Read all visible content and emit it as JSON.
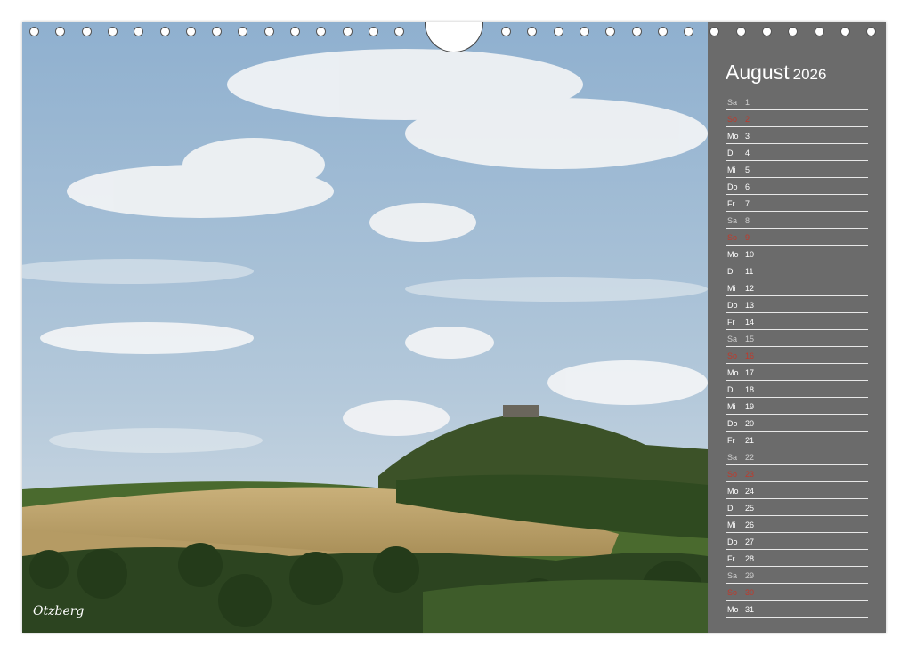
{
  "calendar": {
    "month": "August",
    "year": "2026",
    "caption": "Otzberg",
    "days": [
      {
        "abbr": "Sa",
        "num": "1",
        "kind": "sat"
      },
      {
        "abbr": "So",
        "num": "2",
        "kind": "sun"
      },
      {
        "abbr": "Mo",
        "num": "3",
        "kind": "wk"
      },
      {
        "abbr": "Di",
        "num": "4",
        "kind": "wk"
      },
      {
        "abbr": "Mi",
        "num": "5",
        "kind": "wk"
      },
      {
        "abbr": "Do",
        "num": "6",
        "kind": "wk"
      },
      {
        "abbr": "Fr",
        "num": "7",
        "kind": "wk"
      },
      {
        "abbr": "Sa",
        "num": "8",
        "kind": "sat"
      },
      {
        "abbr": "So",
        "num": "9",
        "kind": "sun"
      },
      {
        "abbr": "Mo",
        "num": "10",
        "kind": "wk"
      },
      {
        "abbr": "Di",
        "num": "11",
        "kind": "wk"
      },
      {
        "abbr": "Mi",
        "num": "12",
        "kind": "wk"
      },
      {
        "abbr": "Do",
        "num": "13",
        "kind": "wk"
      },
      {
        "abbr": "Fr",
        "num": "14",
        "kind": "wk"
      },
      {
        "abbr": "Sa",
        "num": "15",
        "kind": "sat"
      },
      {
        "abbr": "So",
        "num": "16",
        "kind": "sun"
      },
      {
        "abbr": "Mo",
        "num": "17",
        "kind": "wk"
      },
      {
        "abbr": "Di",
        "num": "18",
        "kind": "wk"
      },
      {
        "abbr": "Mi",
        "num": "19",
        "kind": "wk"
      },
      {
        "abbr": "Do",
        "num": "20",
        "kind": "wk"
      },
      {
        "abbr": "Fr",
        "num": "21",
        "kind": "wk"
      },
      {
        "abbr": "Sa",
        "num": "22",
        "kind": "sat"
      },
      {
        "abbr": "So",
        "num": "23",
        "kind": "sun"
      },
      {
        "abbr": "Mo",
        "num": "24",
        "kind": "wk"
      },
      {
        "abbr": "Di",
        "num": "25",
        "kind": "wk"
      },
      {
        "abbr": "Mi",
        "num": "26",
        "kind": "wk"
      },
      {
        "abbr": "Do",
        "num": "27",
        "kind": "wk"
      },
      {
        "abbr": "Fr",
        "num": "28",
        "kind": "wk"
      },
      {
        "abbr": "Sa",
        "num": "29",
        "kind": "sat"
      },
      {
        "abbr": "So",
        "num": "30",
        "kind": "sun"
      },
      {
        "abbr": "Mo",
        "num": "31",
        "kind": "wk"
      }
    ]
  },
  "colors": {
    "panel": "#6b6b6b",
    "sunday": "#c0392b",
    "saturday": "#cfcfcf"
  }
}
